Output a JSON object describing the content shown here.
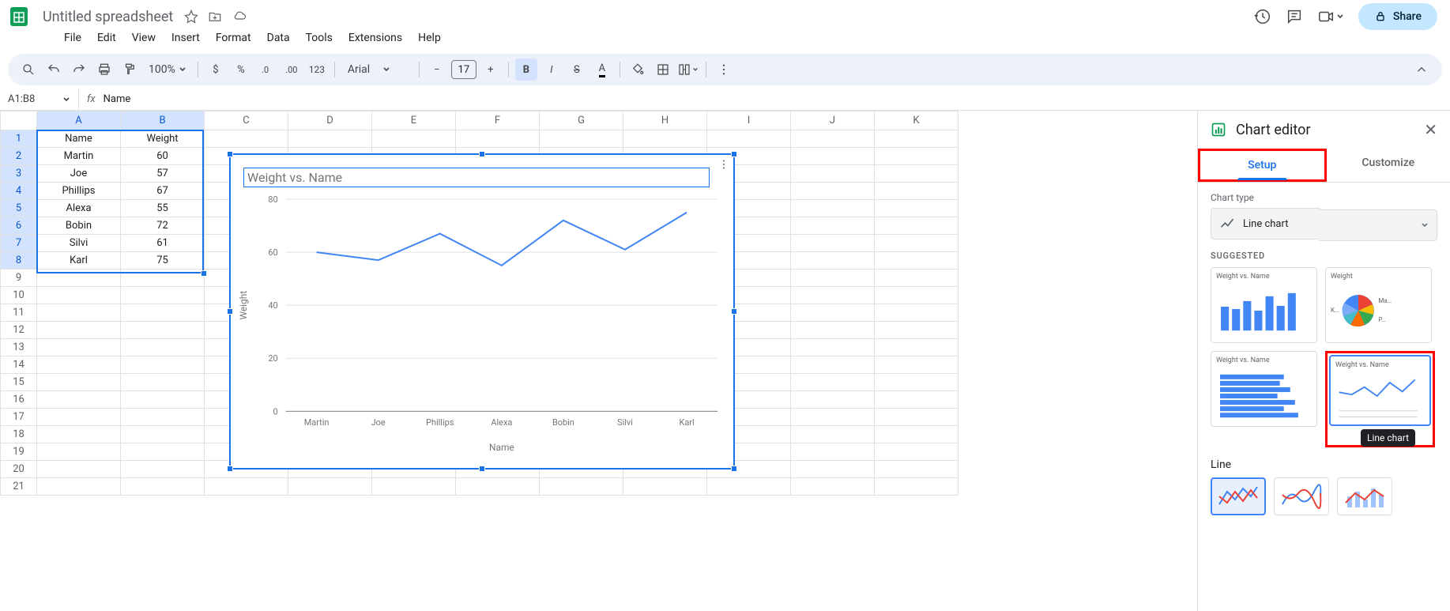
{
  "doc": {
    "title": "Untitled spreadsheet"
  },
  "menu": {
    "file": "File",
    "edit": "Edit",
    "view": "View",
    "insert": "Insert",
    "format": "Format",
    "data": "Data",
    "tools": "Tools",
    "extensions": "Extensions",
    "help": "Help"
  },
  "toolbar": {
    "zoom": "100%",
    "font": "Arial",
    "fontsize": "17",
    "share": "Share"
  },
  "namebox": {
    "ref": "A1:B8",
    "formula": "Name"
  },
  "columns": [
    "A",
    "B",
    "C",
    "D",
    "E",
    "F",
    "G",
    "H",
    "I",
    "J",
    "K"
  ],
  "rows": [
    "1",
    "2",
    "3",
    "4",
    "5",
    "6",
    "7",
    "8",
    "9",
    "10",
    "11",
    "12",
    "13",
    "14",
    "15",
    "16",
    "17",
    "18",
    "19",
    "20",
    "21"
  ],
  "headers": {
    "A": "Name",
    "B": "Weight"
  },
  "table": [
    {
      "name": "Martin",
      "weight": "60"
    },
    {
      "name": "Joe",
      "weight": "57"
    },
    {
      "name": "Phillips",
      "weight": "67"
    },
    {
      "name": "Alexa",
      "weight": "55"
    },
    {
      "name": "Bobin",
      "weight": "72"
    },
    {
      "name": "Silvi",
      "weight": "61"
    },
    {
      "name": "Karl",
      "weight": "75"
    }
  ],
  "chart": {
    "title": "Weight vs. Name",
    "ylabel": "Weight",
    "xlabel": "Name",
    "yticks": [
      "0",
      "20",
      "40",
      "60",
      "80"
    ]
  },
  "chart_data": {
    "type": "line",
    "title": "Weight vs. Name",
    "xlabel": "Name",
    "ylabel": "Weight",
    "categories": [
      "Martin",
      "Joe",
      "Phillips",
      "Alexa",
      "Bobin",
      "Silvi",
      "Karl"
    ],
    "values": [
      60,
      57,
      67,
      55,
      72,
      61,
      75
    ],
    "ylim": [
      0,
      80
    ]
  },
  "editor": {
    "title": "Chart editor",
    "tab_setup": "Setup",
    "tab_customize": "Customize",
    "chart_type_label": "Chart type",
    "chart_type": "Line chart",
    "suggested": "SUGGESTED",
    "thumb1": "Weight vs. Name",
    "thumb2": "Weight",
    "thumb2_labels": {
      "k": "K…",
      "ma": "Ma…",
      "p": "P…"
    },
    "thumb3": "Weight vs. Name",
    "thumb4": "Weight vs. Name",
    "tooltip": "Line chart",
    "line_section": "Line"
  }
}
